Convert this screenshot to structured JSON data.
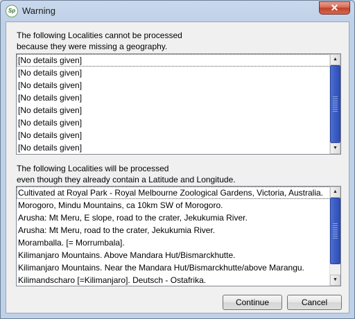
{
  "window": {
    "title": "Warning",
    "app_icon_text": "Sp",
    "close_glyph": "✕"
  },
  "section1": {
    "line1": "The following Localities cannot be processed",
    "line2": "because they were missing a geography.",
    "items": [
      "[No details given]",
      "[No details given]",
      "[No details given]",
      "[No details given]",
      "[No details given]",
      "[No details given]",
      "[No details given]",
      "[No details given]"
    ]
  },
  "section2": {
    "line1": "The following Localities will be processed",
    "line2": "even though they already contain a Latitude and Longitude.",
    "items": [
      "Cultivated at Royal Park - Royal Melbourne Zoological Gardens, Victoria, Australia.",
      "Morogoro, Mindu Mountains, ca 10km SW of Morogoro.",
      "Arusha: Mt Meru, E slope, road to the crater, Jekukumia River.",
      "Arusha: Mt Meru, road to the crater, Jekukumia River.",
      "Moramballa. [= Morrumbala].",
      "Kilimanjaro Mountains. Above Mandara Hut/Bismarckhutte.",
      "Kilimanjaro Mountains. Near the Mandara Hut/Bismarckhutte/above Marangu.",
      "Kilimandscharo [=Kilimanjaro]. Deutsch - Ostafrika."
    ]
  },
  "buttons": {
    "continue": "Continue",
    "cancel": "Cancel"
  },
  "scroll_glyphs": {
    "up": "▲",
    "down": "▼"
  }
}
